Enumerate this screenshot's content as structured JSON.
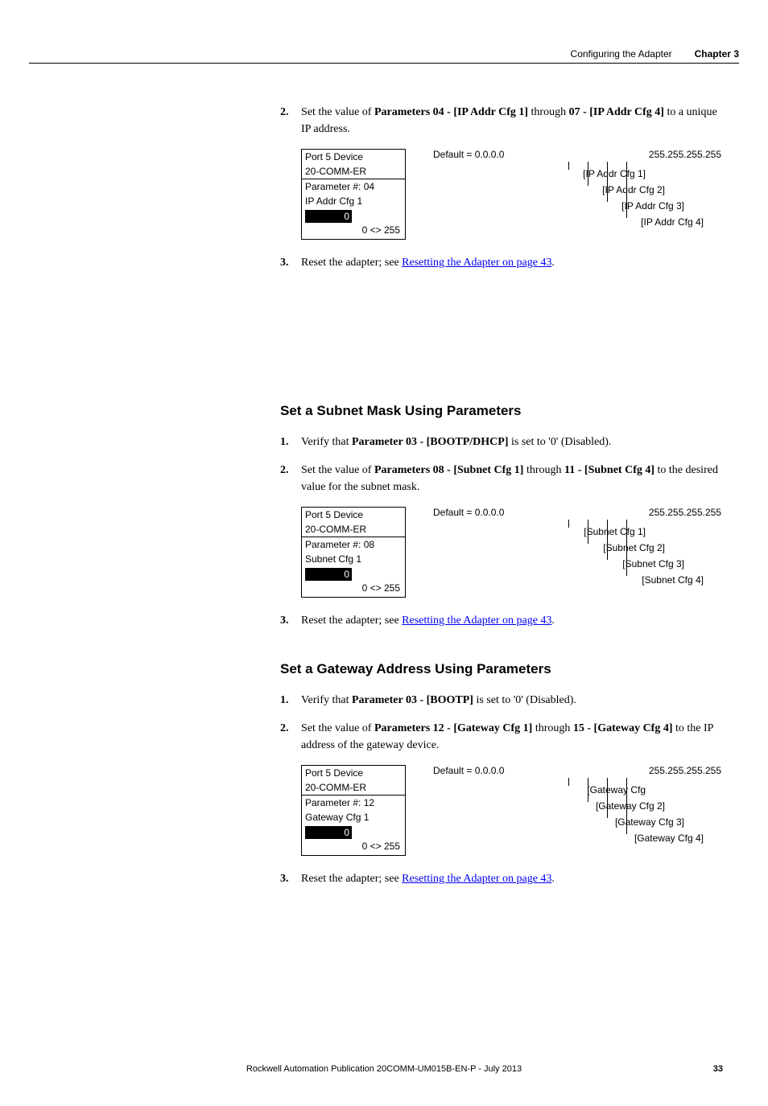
{
  "header": {
    "section": "Configuring the Adapter",
    "chapter": "Chapter 3"
  },
  "section_ip": {
    "step2": {
      "prefix": "Set the value of ",
      "b1": "Parameters 04 - [IP Addr Cfg 1]",
      "mid": " through ",
      "b2": "07 - [IP Addr Cfg 4]",
      "suffix": " to a unique IP address."
    },
    "step3": {
      "prefix": "Reset the adapter; see ",
      "link": "Resetting the Adapter on page 43",
      "suffix": "."
    },
    "panel": {
      "line1": "Port 5 Device",
      "line2": "20-COMM-ER",
      "line3": "Parameter #: 04",
      "line4": "IP Addr Cfg 1",
      "value": "0",
      "range": "0 <> 255"
    },
    "diagram": {
      "default": "Default = 0.0.0.0",
      "max": "255.255.255.255",
      "l1": "[IP Addr Cfg 1]",
      "l2": "[IP Addr Cfg 2]",
      "l3": "[IP Addr Cfg 3]",
      "l4": "[IP Addr Cfg 4]"
    }
  },
  "section_subnet": {
    "title": "Set a Subnet Mask Using Parameters",
    "step1": {
      "prefix": "Verify that ",
      "b1": "Parameter 03 - [BOOTP/DHCP]",
      "suffix": " is set to '0' (Disabled)."
    },
    "step2": {
      "prefix": "Set the value of ",
      "b1": "Parameters 08 - [Subnet Cfg 1]",
      "mid": " through ",
      "b2": "11 - [Subnet Cfg 4]",
      "suffix": " to the desired value for the subnet mask."
    },
    "step3": {
      "prefix": "Reset the adapter; see ",
      "link": "Resetting the Adapter on page 43",
      "suffix": "."
    },
    "panel": {
      "line1": "Port 5 Device",
      "line2": "20-COMM-ER",
      "line3": "Parameter #: 08",
      "line4": "Subnet Cfg 1",
      "value": "0",
      "range": "0 <> 255"
    },
    "diagram": {
      "default": "Default = 0.0.0.0",
      "max": "255.255.255.255",
      "l1": "[Subnet Cfg 1]",
      "l2": "[Subnet Cfg 2]",
      "l3": "[Subnet Cfg 3]",
      "l4": "[Subnet Cfg 4]"
    }
  },
  "section_gateway": {
    "title": "Set a Gateway Address Using Parameters",
    "step1": {
      "prefix": "Verify that ",
      "b1": "Parameter 03 - [BOOTP]",
      "suffix": " is set to '0' (Disabled)."
    },
    "step2": {
      "prefix": "Set the value of ",
      "b1": "Parameters 12 - [Gateway Cfg 1]",
      "mid": " through ",
      "b2": "15 - [Gateway Cfg 4]",
      "suffix": " to the IP address of the gateway device."
    },
    "step3": {
      "prefix": "Reset the adapter; see ",
      "link": "Resetting the Adapter on page 43",
      "suffix": "."
    },
    "panel": {
      "line1": "Port 5 Device",
      "line2": "20-COMM-ER",
      "line3": "Parameter #: 12",
      "line4": "Gateway Cfg 1",
      "value": "0",
      "range": "0 <> 255"
    },
    "diagram": {
      "default": "Default = 0.0.0.0",
      "max": "255.255.255.255",
      "l1": "[Gateway Cfg",
      "l2": "[Gateway Cfg 2]",
      "l3": "[Gateway Cfg 3]",
      "l4": "[Gateway Cfg 4]"
    }
  },
  "footer": {
    "center": "Rockwell Automation Publication  20COMM-UM015B-EN-P - July 2013",
    "page": "33"
  },
  "nums": {
    "n1": "1.",
    "n2": "2.",
    "n3": "3."
  }
}
